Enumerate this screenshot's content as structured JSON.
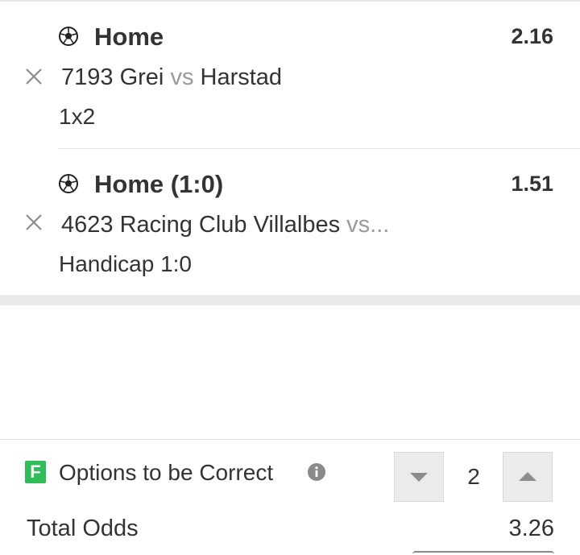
{
  "selections": [
    {
      "pick": "Home",
      "odds": "2.16",
      "match_id": "7193",
      "home_team": "Grei",
      "vs": "vs",
      "away_team": "Harstad",
      "market": "1x2",
      "sport_icon": "soccer-ball-icon"
    },
    {
      "pick": "Home (1:0)",
      "odds": "1.51",
      "match_id": "4623",
      "home_team": "Racing Club Villalbes",
      "vs": "vs...",
      "away_team": "",
      "market": "Handicap 1:0",
      "sport_icon": "soccer-ball-icon"
    }
  ],
  "footer": {
    "options_label": "Options to be Correct",
    "options_icon": "flexi-icon",
    "options_value": "2",
    "total_odds_label": "Total Odds",
    "total_odds_value": "3.26"
  },
  "colors": {
    "flexi_green": "#2ebd59",
    "vs_grey": "#9a9a9a",
    "step_button_bg": "#ebebeb"
  }
}
